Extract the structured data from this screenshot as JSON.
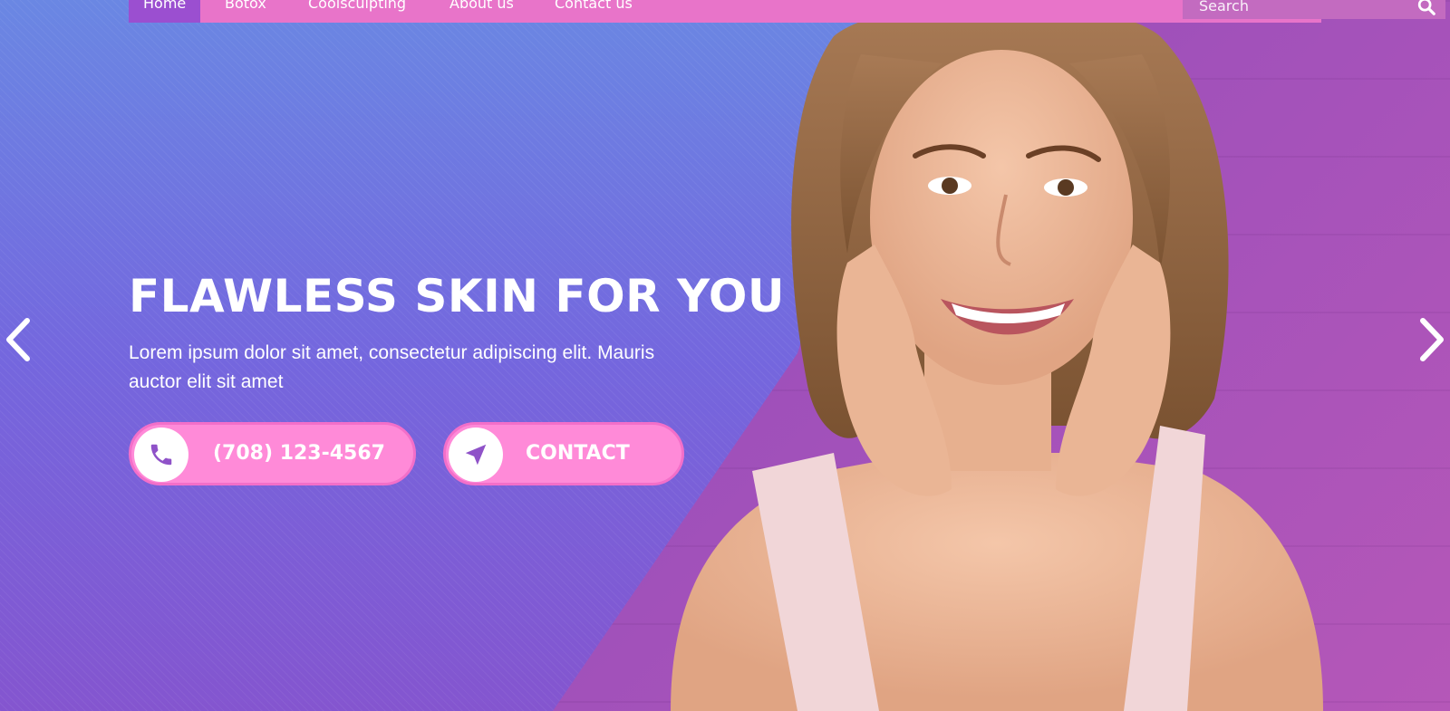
{
  "nav": {
    "items": [
      {
        "label": "Home",
        "active": true
      },
      {
        "label": "Botox"
      },
      {
        "label": "Coolsculpting"
      },
      {
        "label": "About us"
      },
      {
        "label": "Contact us"
      }
    ],
    "search_placeholder": "Search"
  },
  "hero": {
    "title": "FLAWLESS SKIN FOR YOU",
    "subtitle": "Lorem ipsum dolor sit amet, consectetur adipiscing elit. Mauris auctor elit sit amet",
    "phone_label": "(708) 123-4567",
    "contact_label": "CONTACT"
  },
  "icons": {
    "phone": "phone-icon",
    "contact": "navigation-arrow-icon",
    "search": "search-icon",
    "prev": "chevron-left-icon",
    "next": "chevron-right-icon"
  },
  "colors": {
    "navbar": "#e874c9",
    "nav_active": "#9b4fd0",
    "button": "#ff8ad8",
    "icon": "#8f52c8",
    "text": "#ffffff"
  }
}
